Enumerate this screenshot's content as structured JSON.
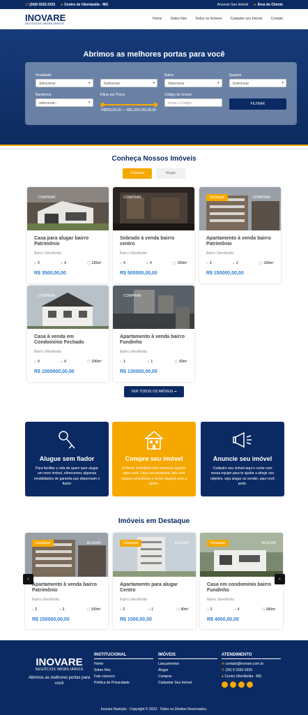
{
  "topbar": {
    "phone": "(34)9 3333-3333",
    "location": "Centro de Uberlandia - MG",
    "announce": "Anuncie Seu Imóvel",
    "client_area": "Área do Cliente"
  },
  "logo": {
    "name": "INOVARE",
    "sub": "NEGÓCIOS IMOBILIÁRIOS"
  },
  "menu": [
    "Home",
    "Sobre Nós",
    "Todos os Imóveis",
    "Cadastre seu Imóvel",
    "Contato"
  ],
  "hero": {
    "title": "Abrimos as melhores portas para você"
  },
  "search": {
    "finalidade_label": "Finalidade",
    "finalidade_value": "Selecionar",
    "tipo_value": "Selecionar",
    "bairro_label": "Bairro",
    "bairro_value": "Selecionar",
    "quartos_label": "Quartos",
    "quartos_value": "Selecionar",
    "banheiros_label": "Banheiros",
    "banheiros_value": "selecionar...",
    "price_label": "Filtrar por Preço",
    "price_range": "R$050,00,00 — R$1,000,050,00,00",
    "codigo_label": "Código do Imovel",
    "codigo_placeholder": "Insira o Código",
    "filter_button": "FILTRAR"
  },
  "properties_section": {
    "title": "Conheça Nossos Imóveis",
    "tab_buy": "Comprar",
    "tab_rent": "Alugar",
    "cards": [
      {
        "tag_left": "COMPRAR",
        "tag_right": "",
        "title": "Casa para alugar bairro Patrimônio",
        "location": "Bairro Uberlândia",
        "beds": "3",
        "baths": "4",
        "area": "125m²",
        "price": "R$ 3500,00,00"
      },
      {
        "tag_left": "COMPRAR",
        "tag_right": "",
        "title": "Sobrado à venda bairro centro",
        "location": "Bairro Uberlândia",
        "beds": "4",
        "baths": "4",
        "area": "150m²",
        "price": "R$ 500000,00,00"
      },
      {
        "tag_left": "Destaque",
        "tag_right": "COMPRAR",
        "title": "Apartamento à venda bairro Patrimônio",
        "location": "Bairro Uberlândia",
        "beds": "2",
        "baths": "2",
        "area": "100m²",
        "price": "R$ 150000,00,00"
      },
      {
        "tag_left": "COMPRAR",
        "tag_right": "",
        "title": "Casa à venda em Condomínio Fechado",
        "location": "Bairro Uberlândia",
        "beds": "4",
        "baths": "4",
        "area": "200m²",
        "price": "R$ 1000000,00,00"
      },
      {
        "tag_left": "COMPRAR",
        "tag_right": "",
        "title": "Apartamento à venda bairro Fundinho",
        "location": "Bairro Uberlândia",
        "beds": "1",
        "baths": "1",
        "area": "60m²",
        "price": "R$ 130000,00,00"
      }
    ],
    "more_button": "VER TODOS OS IMÓVEIS ➞"
  },
  "services": [
    {
      "title": "Alugue sem fiador",
      "text": "Para facilitar a vida de quem quer alugar um novo imóvel, oferecemos algumas modalidades de garantia que dispensam o fiador"
    },
    {
      "title": "Compre seu imóvel",
      "text": "A Home Imobiliária tem inúmeras opções para você. Faça sua pesquisa, fale com nossos consultores e feche negócio com a gente."
    },
    {
      "title": "Anuncie seu imóvel",
      "text": "Cadastre seu imóvel aqui e conte com nossa equipe para te ajudar a atingir seu objetivo, seja alugar ou vender, aqui você pode."
    }
  ],
  "featured": {
    "title": "Imóveis em Destaque",
    "cards": [
      {
        "tag_left": "Destaque",
        "tag_right": "ALUGAR",
        "title": "Apartamento à venda bairro Patrimônio",
        "location": "Bairro Uberlândia",
        "beds": "2",
        "baths": "2",
        "area": "100m²",
        "price": "R$ 150000,00,00"
      },
      {
        "tag_left": "Destaque",
        "tag_right": "ALUGAR",
        "title": "Apartamento para alugar Centro",
        "location": "Bairro Uberlândia",
        "beds": "2",
        "baths": "1",
        "area": "90m²",
        "price": "R$ 1000,00,00"
      },
      {
        "tag_left": "Destaque",
        "tag_right": "ALUGAR",
        "title": "Casa em condomínio bairro Fundinho",
        "location": "Bairro Uberlândia",
        "beds": "3",
        "baths": "4",
        "area": "180m²",
        "price": "R$ 4000,00,00"
      }
    ]
  },
  "footer": {
    "tagline": "Abrimos as melhores portas para você",
    "inst_title": "INSTITUCIONAL",
    "inst_links": [
      "Home",
      "Sobre Nós",
      "Fale conosco",
      "Política de Privacidade"
    ],
    "imoveis_title": "IMÓVEIS",
    "imoveis_links": [
      "Lançamentos",
      "Alugar",
      "Comprar",
      "Cadastrar Seu Imóvel"
    ],
    "atend_title": "ATENDIMENTO",
    "email": "contato@inovare.com.br",
    "phone": "(34) 9 3333-3333",
    "address": "Centro Uberlândia - MG",
    "copyright": "Inovare Nutrição - Copyright © 2023 - Todos os Direitos Reservados."
  },
  "colors": {
    "navy": "#0b2a63",
    "accent": "#f5a800",
    "price": "#2c7dd1"
  }
}
